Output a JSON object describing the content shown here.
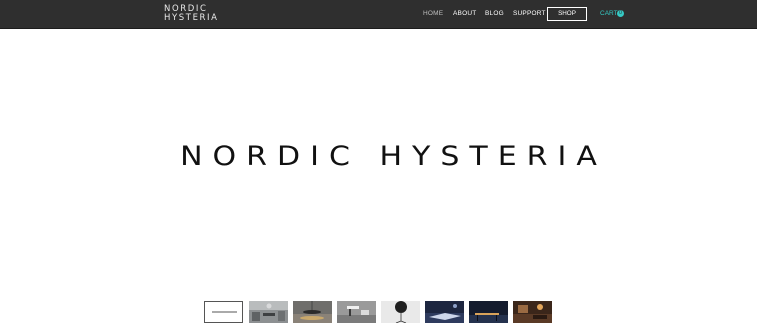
{
  "header": {
    "logo_line1": "NORDIC",
    "logo_line2": "HYSTERIA",
    "nav": [
      {
        "label": "HOME"
      },
      {
        "label": "ABOUT"
      },
      {
        "label": "BLOG"
      },
      {
        "label": "SUPPORT"
      }
    ],
    "shop_label": "SHOP",
    "cart_label": "CART",
    "cart_count": "0",
    "accent_color": "#35c9c4"
  },
  "hero": {
    "title": "NORDIC HYSTERIA"
  },
  "gallery": {
    "selected_index": 0,
    "thumbnails": [
      {
        "label": "nordic-hysteria-title-slide"
      },
      {
        "label": "interior-room-photo"
      },
      {
        "label": "pendant-lamp-photo"
      },
      {
        "label": "desk-lamp-photo"
      },
      {
        "label": "floor-lamp-photo"
      },
      {
        "label": "night-scene-photo"
      },
      {
        "label": "dark-interior-photo"
      },
      {
        "label": "warm-interior-photo"
      }
    ]
  }
}
